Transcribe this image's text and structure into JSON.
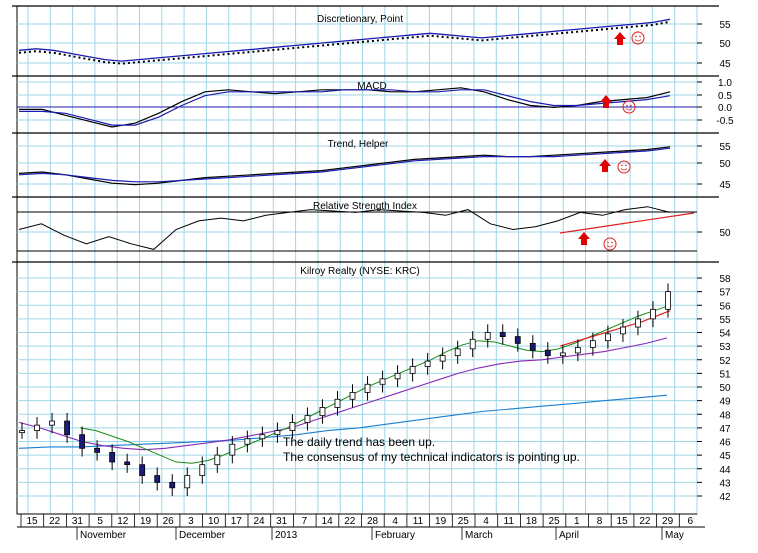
{
  "chart_data": {
    "type": "line",
    "x_month_labels": [
      "November",
      "December",
      "2013",
      "February",
      "March",
      "April",
      "May"
    ],
    "x_day_labels": [
      "15",
      "22",
      "31",
      "5",
      "12",
      "19",
      "26",
      "3",
      "10",
      "17",
      "24",
      "31",
      "7",
      "14",
      "22",
      "28",
      "4",
      "11",
      "19",
      "25",
      "4",
      "11",
      "18",
      "25",
      "1",
      "8",
      "15",
      "22",
      "29",
      "6"
    ],
    "panels": [
      {
        "title": "Discretionary, Point",
        "yticks": [
          45,
          50,
          55
        ],
        "ylim": [
          40,
          60
        ],
        "series": [
          {
            "values": [
              47,
              47.5,
              47,
              46,
              45,
              44,
              43.5,
              44,
              44.5,
              45,
              45.5,
              46,
              46.5,
              47,
              47.5,
              48,
              48.5,
              49,
              49.5,
              50,
              50.5,
              51,
              51.5,
              52,
              52.5,
              52,
              51.5,
              51,
              51.5,
              52,
              52.5,
              53,
              53.5,
              54,
              54.5,
              55,
              55.5,
              56,
              57
            ]
          }
        ]
      },
      {
        "title": "MACD",
        "yticks": [
          "1.0",
          "0.5",
          "0.0",
          "-0.5"
        ],
        "ylim": [
          -1.0,
          1.5
        ],
        "series": [
          {
            "values": [
              0.0,
              0.0,
              -0.3,
              -0.6,
              -0.9,
              -0.7,
              -0.2,
              0.4,
              0.9,
              1.0,
              0.9,
              0.8,
              0.9,
              1.0,
              1.0,
              1.0,
              0.9,
              0.9,
              1.0,
              1.1,
              0.9,
              0.5,
              0.2,
              0.1,
              0.2,
              0.4,
              0.5,
              0.6,
              0.9
            ]
          },
          {
            "values": [
              -0.1,
              -0.1,
              -0.2,
              -0.5,
              -0.8,
              -0.8,
              -0.4,
              0.2,
              0.7,
              0.9,
              0.9,
              0.9,
              0.9,
              0.9,
              1.0,
              1.0,
              1.0,
              0.9,
              0.9,
              1.0,
              1.0,
              0.7,
              0.4,
              0.2,
              0.2,
              0.3,
              0.4,
              0.5,
              0.7
            ]
          }
        ]
      },
      {
        "title": "Trend, Helper",
        "yticks": [
          45,
          50,
          55
        ],
        "ylim": [
          40,
          60
        ],
        "series": [
          {
            "values": [
              47,
              47.5,
              46.5,
              45,
              43.5,
              43,
              43.5,
              44.5,
              45.5,
              46,
              46.5,
              47,
              47.5,
              48,
              49,
              50,
              51,
              52,
              52.5,
              53,
              53.5,
              53,
              53,
              53.5,
              54,
              54.5,
              55,
              55.5,
              56.5
            ]
          },
          {
            "values": [
              46.5,
              47,
              46.5,
              45.5,
              44.5,
              44,
              44,
              44.5,
              45,
              45.5,
              46,
              46.5,
              47,
              47.5,
              48.5,
              49.5,
              50.5,
              51.5,
              52,
              52.5,
              53,
              53,
              53,
              53,
              53.5,
              54,
              54.5,
              55,
              56
            ]
          }
        ]
      },
      {
        "title": "Relative Strength Index",
        "yticks": [
          50
        ],
        "ylim": [
          30,
          70
        ],
        "series": [
          {
            "values": [
              50,
              54,
              46,
              40,
              45,
              40,
              36,
              50,
              56,
              58,
              56,
              60,
              62,
              64,
              63,
              62,
              64,
              63,
              62,
              60,
              64,
              54,
              50,
              52,
              56,
              62,
              60,
              64,
              66,
              62
            ]
          }
        ]
      },
      {
        "title": "Kilroy Realty (NYSE: KRC)",
        "yticks": [
          42,
          43,
          44,
          45,
          46,
          47,
          48,
          49,
          50,
          51,
          52,
          53,
          54,
          55,
          56,
          57,
          58
        ],
        "ylim": [
          41.5,
          58.5
        ],
        "series": [
          {
            "values": [
              46.8,
              47.2,
              47.5,
              46.5,
              45.5,
              45.2,
              44.5,
              44.3,
              43.5,
              43.0,
              42.6,
              43.5,
              44.3,
              45.0,
              45.8,
              46.2,
              46.5,
              46.8,
              47.4,
              47.9,
              48.5,
              49.1,
              49.6,
              50.2,
              50.6,
              51.0,
              51.5,
              51.9,
              52.3,
              52.8,
              53.5,
              54.0,
              53.7,
              53.2,
              52.7,
              52.3,
              52.5,
              52.9,
              53.4,
              53.9,
              54.4,
              55.0,
              55.7,
              57.0
            ]
          },
          {
            "values": [
              47.0,
              46.8,
              46.4,
              46.0,
              45.5,
              45.0,
              44.5,
              44.4,
              44.6,
              45.0,
              45.5,
              46.0,
              46.5,
              47.0,
              47.6,
              48.2,
              48.8,
              49.4,
              50.0,
              50.5,
              51.0,
              51.5,
              52.0,
              52.6,
              53.1,
              53.4,
              53.3,
              53.0,
              52.7,
              52.6,
              52.8,
              53.2,
              53.7,
              54.2,
              54.7,
              55.2,
              55.6,
              56.0
            ]
          },
          {
            "values": [
              47.4,
              47.0,
              46.5,
              46.0,
              45.7,
              45.5,
              45.4,
              45.5,
              45.7,
              45.9,
              46.1,
              46.4,
              46.7,
              47.0,
              47.5,
              48.0,
              48.5,
              49.0,
              49.5,
              50.0,
              50.5,
              51.0,
              51.4,
              51.7,
              51.9,
              52.0,
              52.2,
              52.4,
              52.6,
              52.9,
              53.2,
              53.6
            ]
          },
          {
            "values": [
              45.5,
              45.6,
              45.6,
              45.7,
              45.8,
              45.9,
              46.0,
              46.1,
              46.3,
              46.5,
              46.8,
              47.0,
              47.3,
              47.6,
              47.9,
              48.2,
              48.4,
              48.6,
              48.8,
              49.0,
              49.2,
              49.4
            ]
          },
          {
            "values": [
              53.0,
              53.6,
              54.2,
              54.8,
              55.6
            ]
          }
        ]
      }
    ],
    "annotations": [
      "The daily trend has been up.",
      "The consensus of my technical indicators is pointing up."
    ]
  }
}
